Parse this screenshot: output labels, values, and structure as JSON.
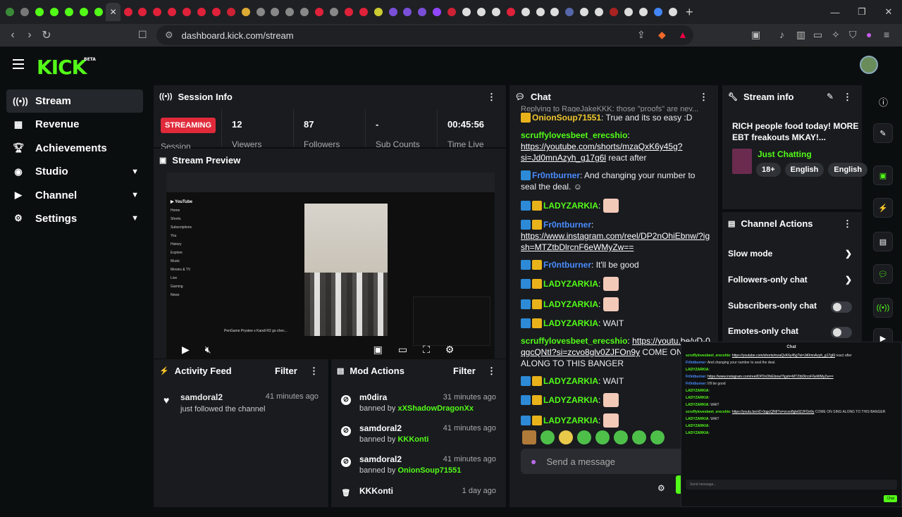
{
  "browser": {
    "url": "dashboard.kick.com/stream",
    "tab_count": 52
  },
  "brand": {
    "logo": "KICK",
    "logo_sup": "BETA",
    "accent": "#53fc18"
  },
  "sidebar": {
    "items": [
      {
        "label": "Stream",
        "icon": "broadcast-icon",
        "expandable": false
      },
      {
        "label": "Revenue",
        "icon": "revenue-icon",
        "expandable": false
      },
      {
        "label": "Achievements",
        "icon": "trophy-icon",
        "expandable": false
      },
      {
        "label": "Studio",
        "icon": "studio-icon",
        "expandable": true
      },
      {
        "label": "Channel",
        "icon": "channel-icon",
        "expandable": true
      },
      {
        "label": "Settings",
        "icon": "gear-icon",
        "expandable": true
      }
    ]
  },
  "session": {
    "title": "Session Info",
    "status": "STREAMING",
    "status_label": "Session",
    "stats": [
      {
        "value": "12",
        "label": "Viewers"
      },
      {
        "value": "87",
        "label": "Followers"
      },
      {
        "value": "-",
        "label": "Sub Counts"
      },
      {
        "value": "00:45:56",
        "label": "Time Live"
      }
    ]
  },
  "preview": {
    "title": "Stream Preview",
    "yt_caption": "PenGame Prystee x Kandi R2 go chec..."
  },
  "activity": {
    "title": "Activity Feed",
    "filter": "Filter",
    "items": [
      {
        "name": "samdoral2",
        "text": "just followed the channel",
        "time": "41 minutes ago"
      }
    ]
  },
  "mod": {
    "title": "Mod Actions",
    "filter": "Filter",
    "items": [
      {
        "name": "m0dira",
        "by_prefix": "banned by",
        "by": "xXShadowDragonXx",
        "time": "31 minutes ago"
      },
      {
        "name": "samdoral2",
        "by_prefix": "banned by",
        "by": "KKKonti",
        "time": "41 minutes ago"
      },
      {
        "name": "samdoral2",
        "by_prefix": "banned by",
        "by": "OnionSoup71551",
        "time": "41 minutes ago"
      },
      {
        "name": "KKKonti",
        "by_prefix": "",
        "by": "",
        "time": "1 day ago"
      }
    ]
  },
  "chat": {
    "title": "Chat",
    "reply_line": "Replying to RageJakeKKK: those \"proofs\" are nev...",
    "m1_user": "OnionSoup71551",
    "m1_text": "True and its so easy :D",
    "m2_user": "scruffylovesbeet_erecshio",
    "m2_link": "https://youtube.com/shorts/mzaQxK6y45g?si=Jd0mnAzyh_g17g6l",
    "m2_text": "react after",
    "m3_user": "Fr0ntburner",
    "m3_text": "And changing your number to seal the deal.",
    "m4_user": "LADYZARKIA",
    "m5_user": "Fr0ntburner",
    "m5_link": "https://www.instagram.com/reel/DP2nOhiEbnw/?igsh=MTZtbDlrcnF6eWMyZw==",
    "m6_user": "Fr0ntburner",
    "m6_text": "It'll be good",
    "m7_user": "LADYZARKIA",
    "m8_user": "LADYZARKIA",
    "m9_user": "LADYZARKIA",
    "m9_text": "WAIT",
    "m10_user": "scruffylovesbeet_erecshio",
    "m10_link": "https://youtu.be/vD-0qgcQNtI?si=zcvo8glv0ZJFOn9y",
    "m10_text": "COME ON SING ALONG TO THIS BANGER",
    "m11_user": "LADYZARKIA",
    "m11_text": "WAIT",
    "m12_user": "LADYZARKIA",
    "m13_user": "LADYZARKIA",
    "input_placeholder": "Send a message"
  },
  "stream_info": {
    "title": "Stream info",
    "stream_title": "RICH people food today! MORE EBT freakouts MKAY!...",
    "category": "Just Chatting",
    "tags": [
      "18+",
      "English",
      "English"
    ]
  },
  "channel_actions": {
    "title": "Channel Actions",
    "rows": [
      {
        "label": "Slow mode",
        "control": "chevron"
      },
      {
        "label": "Followers-only chat",
        "control": "chevron"
      },
      {
        "label": "Subscribers-only chat",
        "control": "toggle"
      },
      {
        "label": "Emotes-only chat",
        "control": "toggle"
      }
    ]
  },
  "popout": {
    "title": "Chat",
    "input_placeholder": "Send message...",
    "send_label": "Chat"
  }
}
